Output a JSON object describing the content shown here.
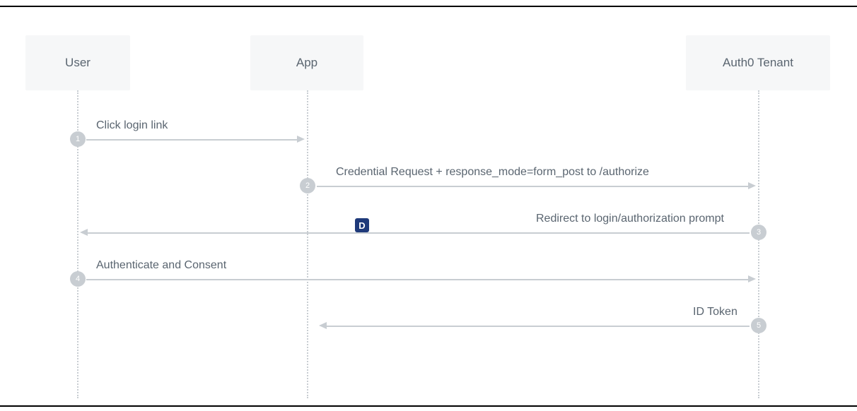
{
  "participants": {
    "user": {
      "label": "User"
    },
    "app": {
      "label": "App"
    },
    "tenant": {
      "label": "Auth0 Tenant"
    }
  },
  "steps": {
    "s1": {
      "num": "1",
      "label": "Click login link"
    },
    "s2": {
      "num": "2",
      "label": "Credential Request + response_mode=form_post to /authorize"
    },
    "s3": {
      "num": "3",
      "label": "Redirect to login/authorization prompt"
    },
    "s4": {
      "num": "4",
      "label": "Authenticate and Consent"
    },
    "s5": {
      "num": "5",
      "label": "ID Token"
    }
  },
  "badge": {
    "letter": "D"
  },
  "chart_data": {
    "type": "sequence-diagram",
    "participants": [
      "User",
      "App",
      "Auth0 Tenant"
    ],
    "messages": [
      {
        "step": 1,
        "from": "User",
        "to": "App",
        "text": "Click login link"
      },
      {
        "step": 2,
        "from": "App",
        "to": "Auth0 Tenant",
        "text": "Credential Request + response_mode=form_post to /authorize"
      },
      {
        "step": 3,
        "from": "Auth0 Tenant",
        "to": "User",
        "text": "Redirect to login/authorization prompt"
      },
      {
        "step": 4,
        "from": "User",
        "to": "Auth0 Tenant",
        "text": "Authenticate and Consent"
      },
      {
        "step": 5,
        "from": "Auth0 Tenant",
        "to": "App",
        "text": "ID Token"
      }
    ]
  }
}
